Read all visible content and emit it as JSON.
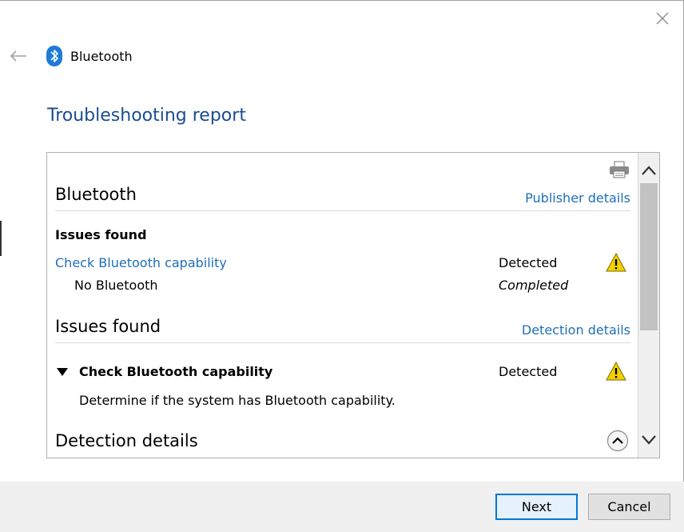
{
  "window": {
    "app_title": "Bluetooth",
    "page_title": "Troubleshooting report"
  },
  "report": {
    "section1": {
      "heading": "Bluetooth",
      "link": "Publisher details"
    },
    "summary": {
      "label": "Issues found",
      "issue_link": "Check Bluetooth capability",
      "issue_status": "Detected",
      "sub_item": "No Bluetooth",
      "sub_status": "Completed"
    },
    "section2": {
      "heading": "Issues found",
      "link": "Detection details",
      "item_title": "Check Bluetooth capability",
      "item_status": "Detected",
      "item_desc": "Determine if the system has Bluetooth capability."
    },
    "section3": {
      "heading": "Detection details"
    }
  },
  "footer": {
    "next_label": "Next",
    "cancel_label": "Cancel"
  },
  "colors": {
    "title_blue": "#1a4d8f",
    "link_blue": "#1e6fb8",
    "warning_yellow": "#f3d100",
    "primary_border": "#0078d7"
  }
}
